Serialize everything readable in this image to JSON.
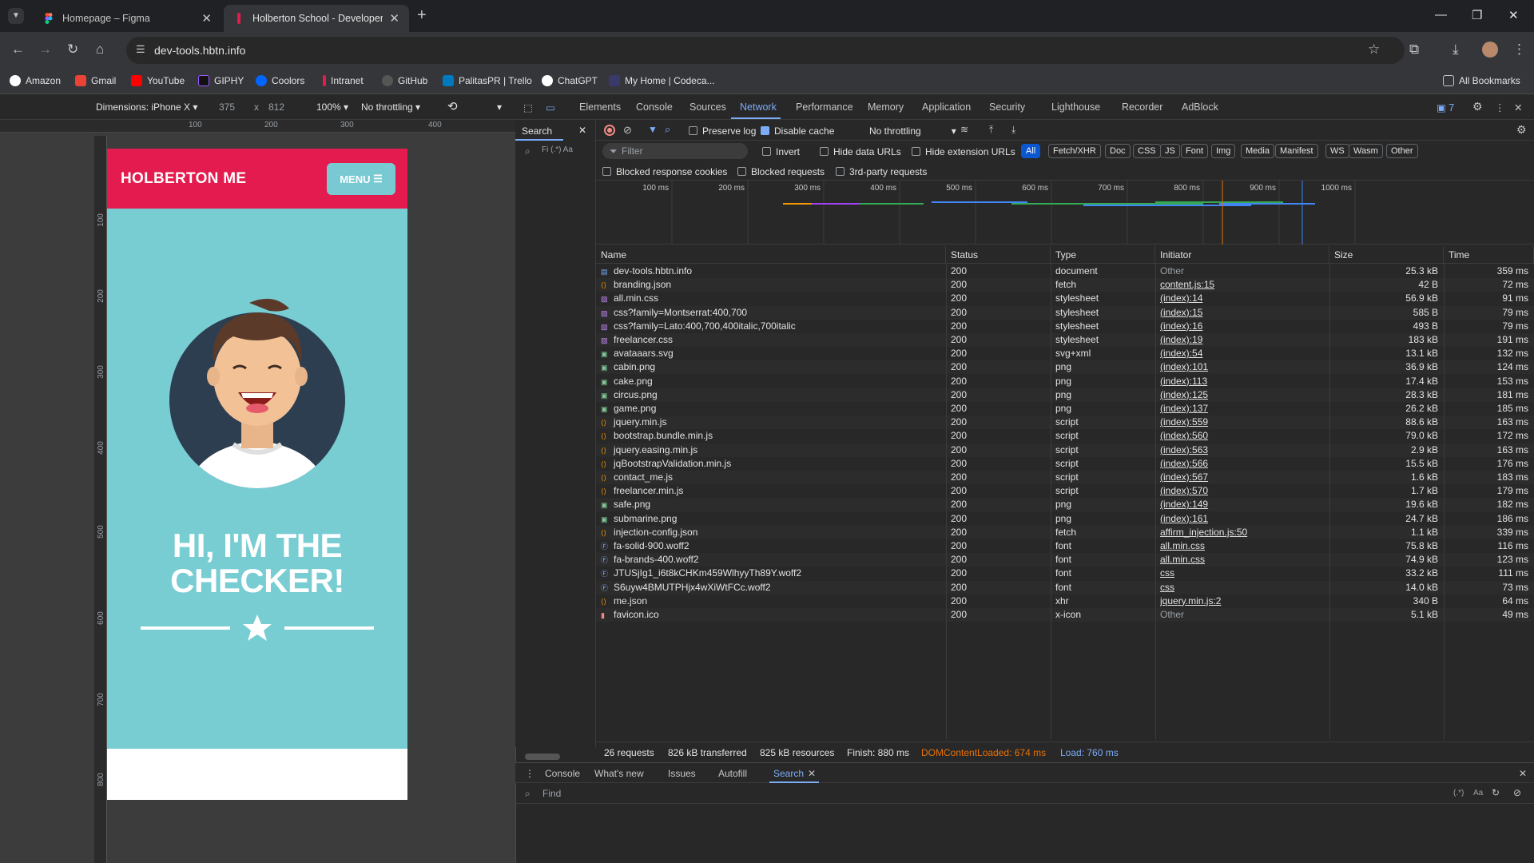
{
  "browser": {
    "tabs": [
      {
        "title": "Homepage – Figma",
        "icon": "figma-icon"
      },
      {
        "title": "Holberton School - Developer t",
        "icon": "holberton-icon"
      }
    ],
    "url": "dev-tools.hbtn.info",
    "bookmarks": [
      "Amazon",
      "Gmail",
      "YouTube",
      "GIPHY",
      "Coolors",
      "Intranet",
      "GitHub",
      "PalitasPR | Trello",
      "ChatGPT",
      "My Home | Codeca..."
    ],
    "all_bookmarks": "All Bookmarks"
  },
  "device_toolbar": {
    "dimensions": "Dimensions: iPhone X",
    "width": "375",
    "x": "x",
    "height": "812",
    "zoom": "100%",
    "throttling": "No throttling"
  },
  "rulers": {
    "top": [
      "100",
      "200",
      "300",
      "400"
    ],
    "left": [
      "100",
      "200",
      "300",
      "400",
      "500",
      "600",
      "700",
      "800"
    ]
  },
  "site": {
    "brand": "HOLBERTON ME",
    "menu": "MENU",
    "hero_line1": "HI, I'M THE",
    "hero_line2": "CHECKER!",
    "header_color": "#e31b4e",
    "hero_color": "#78cdd3"
  },
  "devtools": {
    "tabs": [
      "Elements",
      "Console",
      "Sources",
      "Network",
      "Performance",
      "Memory",
      "Application",
      "Security",
      "Lighthouse",
      "Recorder",
      "AdBlock"
    ],
    "active_tab": "Network",
    "issues_count": "7",
    "search_tab": "Search",
    "search_options": "Fi (.*) Aa",
    "preserve_log": "Preserve log",
    "disable_cache": "Disable cache",
    "throttling": "No throttling",
    "filter_placeholder": "Filter",
    "invert": "Invert",
    "hide_data_urls": "Hide data URLs",
    "hide_extension_urls": "Hide extension URLs",
    "type_filters": [
      "All",
      "Fetch/XHR",
      "Doc",
      "CSS",
      "JS",
      "Font",
      "Img",
      "Media",
      "Manifest",
      "WS",
      "Wasm",
      "Other"
    ],
    "blocked_cookies": "Blocked response cookies",
    "blocked_requests": "Blocked requests",
    "third_party": "3rd-party requests",
    "timeline_ticks": [
      "100 ms",
      "200 ms",
      "300 ms",
      "400 ms",
      "500 ms",
      "600 ms",
      "700 ms",
      "800 ms",
      "900 ms",
      "1000 ms"
    ],
    "columns": [
      "Name",
      "Status",
      "Type",
      "Initiator",
      "Size",
      "Time"
    ],
    "requests": [
      {
        "name": "dev-tools.hbtn.info",
        "status": "200",
        "type": "document",
        "initiator": "Other",
        "size": "25.3 kB",
        "time": "359 ms",
        "icon": "doc"
      },
      {
        "name": "branding.json",
        "status": "200",
        "type": "fetch",
        "initiator": "content.js:15",
        "size": "42 B",
        "time": "72 ms",
        "icon": "json"
      },
      {
        "name": "all.min.css",
        "status": "200",
        "type": "stylesheet",
        "initiator": "(index):14",
        "size": "56.9 kB",
        "time": "91 ms",
        "icon": "css"
      },
      {
        "name": "css?family=Montserrat:400,700",
        "status": "200",
        "type": "stylesheet",
        "initiator": "(index):15",
        "size": "585 B",
        "time": "79 ms",
        "icon": "css"
      },
      {
        "name": "css?family=Lato:400,700,400italic,700italic",
        "status": "200",
        "type": "stylesheet",
        "initiator": "(index):16",
        "size": "493 B",
        "time": "79 ms",
        "icon": "css"
      },
      {
        "name": "freelancer.css",
        "status": "200",
        "type": "stylesheet",
        "initiator": "(index):19",
        "size": "183 kB",
        "time": "191 ms",
        "icon": "css"
      },
      {
        "name": "avataaars.svg",
        "status": "200",
        "type": "svg+xml",
        "initiator": "(index):54",
        "size": "13.1 kB",
        "time": "132 ms",
        "icon": "img"
      },
      {
        "name": "cabin.png",
        "status": "200",
        "type": "png",
        "initiator": "(index):101",
        "size": "36.9 kB",
        "time": "124 ms",
        "icon": "img"
      },
      {
        "name": "cake.png",
        "status": "200",
        "type": "png",
        "initiator": "(index):113",
        "size": "17.4 kB",
        "time": "153 ms",
        "icon": "img"
      },
      {
        "name": "circus.png",
        "status": "200",
        "type": "png",
        "initiator": "(index):125",
        "size": "28.3 kB",
        "time": "181 ms",
        "icon": "img"
      },
      {
        "name": "game.png",
        "status": "200",
        "type": "png",
        "initiator": "(index):137",
        "size": "26.2 kB",
        "time": "185 ms",
        "icon": "img"
      },
      {
        "name": "jquery.min.js",
        "status": "200",
        "type": "script",
        "initiator": "(index):559",
        "size": "88.6 kB",
        "time": "163 ms",
        "icon": "js"
      },
      {
        "name": "bootstrap.bundle.min.js",
        "status": "200",
        "type": "script",
        "initiator": "(index):560",
        "size": "79.0 kB",
        "time": "172 ms",
        "icon": "js"
      },
      {
        "name": "jquery.easing.min.js",
        "status": "200",
        "type": "script",
        "initiator": "(index):563",
        "size": "2.9 kB",
        "time": "163 ms",
        "icon": "js"
      },
      {
        "name": "jqBootstrapValidation.min.js",
        "status": "200",
        "type": "script",
        "initiator": "(index):566",
        "size": "15.5 kB",
        "time": "176 ms",
        "icon": "js"
      },
      {
        "name": "contact_me.js",
        "status": "200",
        "type": "script",
        "initiator": "(index):567",
        "size": "1.6 kB",
        "time": "183 ms",
        "icon": "js"
      },
      {
        "name": "freelancer.min.js",
        "status": "200",
        "type": "script",
        "initiator": "(index):570",
        "size": "1.7 kB",
        "time": "179 ms",
        "icon": "js"
      },
      {
        "name": "safe.png",
        "status": "200",
        "type": "png",
        "initiator": "(index):149",
        "size": "19.6 kB",
        "time": "182 ms",
        "icon": "img"
      },
      {
        "name": "submarine.png",
        "status": "200",
        "type": "png",
        "initiator": "(index):161",
        "size": "24.7 kB",
        "time": "186 ms",
        "icon": "img"
      },
      {
        "name": "injection-config.json",
        "status": "200",
        "type": "fetch",
        "initiator": "affirm_injection.js:50",
        "size": "1.1 kB",
        "time": "339 ms",
        "icon": "json"
      },
      {
        "name": "fa-solid-900.woff2",
        "status": "200",
        "type": "font",
        "initiator": "all.min.css",
        "size": "75.8 kB",
        "time": "116 ms",
        "icon": "font"
      },
      {
        "name": "fa-brands-400.woff2",
        "status": "200",
        "type": "font",
        "initiator": "all.min.css",
        "size": "74.9 kB",
        "time": "123 ms",
        "icon": "font"
      },
      {
        "name": "JTUSjIg1_i6t8kCHKm459WlhyyTh89Y.woff2",
        "status": "200",
        "type": "font",
        "initiator": "css",
        "size": "33.2 kB",
        "time": "111 ms",
        "icon": "font"
      },
      {
        "name": "S6uyw4BMUTPHjx4wXiWtFCc.woff2",
        "status": "200",
        "type": "font",
        "initiator": "css",
        "size": "14.0 kB",
        "time": "73 ms",
        "icon": "font"
      },
      {
        "name": "me.json",
        "status": "200",
        "type": "xhr",
        "initiator": "jquery.min.js:2",
        "size": "340 B",
        "time": "64 ms",
        "icon": "json"
      },
      {
        "name": "favicon.ico",
        "status": "200",
        "type": "x-icon",
        "initiator": "Other",
        "size": "5.1 kB",
        "time": "49 ms",
        "icon": "ico"
      }
    ],
    "summary": {
      "requests": "26 requests",
      "transferred": "826 kB transferred",
      "resources": "825 kB resources",
      "finish": "Finish: 880 ms",
      "dcl": "DOMContentLoaded: 674 ms",
      "load": "Load: 760 ms"
    },
    "drawer_tabs": [
      "Console",
      "What's new",
      "Issues",
      "Autofill",
      "Search"
    ],
    "drawer_active": "Search",
    "find_placeholder": "Find",
    "colors": {
      "accent": "#7cacf8",
      "dcl": "#e8710a",
      "load": "#7cacf8"
    }
  }
}
